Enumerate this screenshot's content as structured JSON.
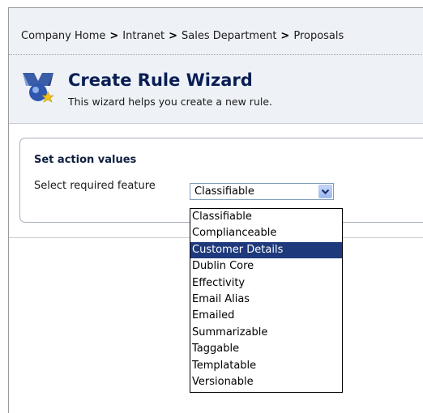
{
  "breadcrumb": {
    "items": [
      "Company Home",
      "Intranet",
      "Sales Department",
      "Proposals"
    ],
    "separator": ">"
  },
  "wizard": {
    "title": "Create Rule Wizard",
    "subtitle": "This wizard helps you create a new rule.",
    "icon": "wizard-icon"
  },
  "section": {
    "title": "Set action values",
    "feature_label": "Select required feature"
  },
  "feature_select": {
    "value": "Classifiable",
    "options": [
      "Classifiable",
      "Complianceable",
      "Customer Details",
      "Dublin Core",
      "Effectivity",
      "Email Alias",
      "Emailed",
      "Summarizable",
      "Taggable",
      "Templatable",
      "Versionable"
    ],
    "highlighted": "Customer Details"
  },
  "colors": {
    "header_bg": "#eef2f7",
    "title": "#0a1e54",
    "highlight": "#1e3a7c"
  }
}
